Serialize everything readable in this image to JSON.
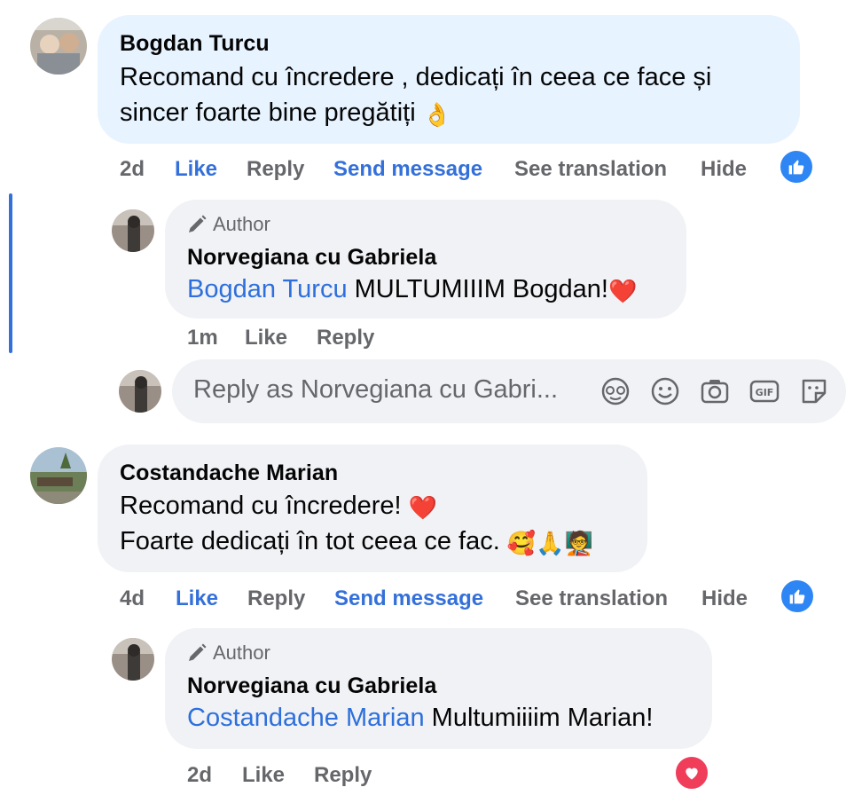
{
  "comments": [
    {
      "author": "Bogdan Turcu",
      "lines": [
        "Recomand cu încredere , dedicați în ceea ce face și",
        "sincer foarte bine pregătiți"
      ],
      "emoji_line2": "👌",
      "time": "2d",
      "actions": {
        "like": "Like",
        "reply": "Reply",
        "send_message": "Send message",
        "see_translation": "See translation",
        "hide": "Hide"
      },
      "reaction": "like-icon",
      "reply": {
        "badge": "Author",
        "author": "Norvegiana cu Gabriela",
        "mention": "Bogdan Turcu",
        "text": " MULTUMIIIM Bogdan!",
        "emoji": "❤️",
        "time": "1m",
        "actions": {
          "like": "Like",
          "reply": "Reply"
        }
      }
    },
    {
      "author": "Costandache Marian",
      "lines": [
        "Recomand cu încredere! ",
        "Foarte dedicați în tot ceea ce fac. "
      ],
      "emoji_line1": "❤️",
      "emoji_line2": "🥰🙏🧑‍🏫",
      "time": "4d",
      "actions": {
        "like": "Like",
        "reply": "Reply",
        "send_message": "Send message",
        "see_translation": "See translation",
        "hide": "Hide"
      },
      "reaction": "like-icon",
      "reply": {
        "badge": "Author",
        "author": "Norvegiana cu Gabriela",
        "mention": "Costandache Marian",
        "text": " Multumiiiim Marian!",
        "time": "2d",
        "actions": {
          "like": "Like",
          "reply": "Reply"
        },
        "reaction": "heart-icon"
      }
    }
  ],
  "reply_box": {
    "placeholder": "Reply as Norvegiana cu Gabri...",
    "icons": [
      "avatar-sticker-icon",
      "emoji-icon",
      "camera-icon",
      "gif-icon",
      "sticker-icon"
    ]
  },
  "colors": {
    "accent": "#3470d9",
    "bubble": "#f0f2f5",
    "highlight_bubble": "#e7f3ff",
    "like": "#2e86f5",
    "heart": "#ef3d5a"
  }
}
